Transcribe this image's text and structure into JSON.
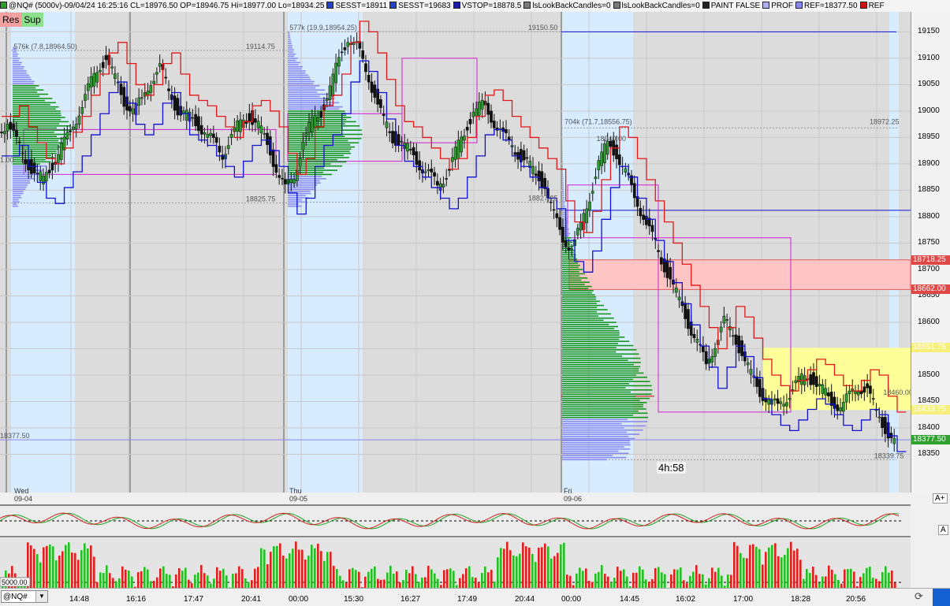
{
  "header": {
    "items": [
      {
        "text": "@NQ# (5000v)-09/04/24 16:25:16 CL=18976.50 OP=18946.75 Hi=18977.00 Lo=18934.25",
        "color": "#2aa02a"
      },
      {
        "text": "SESST=18911",
        "color": "#2244cc"
      },
      {
        "text": "SESST=19683",
        "color": "#2244cc"
      },
      {
        "text": "VSTOP=18878.5",
        "color": "#1a1aa8"
      },
      {
        "text": "lsLookBackCandles=0",
        "color": "#7a7a7a"
      },
      {
        "text": "lsLookBackCandles=0",
        "color": "#7a7a7a"
      },
      {
        "text": "PAINT FALSE",
        "color": "#222222"
      },
      {
        "text": "PROF",
        "color": "#b0b0f0"
      },
      {
        "text": "REF=18377.50",
        "color": "#8888ee"
      },
      {
        "text": "REF",
        "color": "#d01010"
      }
    ]
  },
  "buttons": {
    "res_label": "Res",
    "sup_label": "Sup",
    "a_plus": "A+",
    "a_label": "A"
  },
  "price_axis": {
    "ticks": [
      19150,
      19100,
      19050,
      19000,
      18950,
      18900,
      18850,
      18800,
      18750,
      18700,
      18650,
      18600,
      18550,
      18500,
      18450,
      18400,
      18350
    ],
    "tags": [
      {
        "text": "18718.25",
        "value": 18718.25,
        "bg": "#e04848"
      },
      {
        "text": "18662.00",
        "value": 18662.0,
        "bg": "#e04848"
      },
      {
        "text": "18551.75",
        "value": 18551.75,
        "bg": "#f6ef7a"
      },
      {
        "text": "18433.75",
        "value": 18433.75,
        "bg": "#f6ef7a"
      },
      {
        "text": "18377.50",
        "value": 18377.5,
        "bg": "#30a030"
      }
    ]
  },
  "chart_labels": [
    {
      "text": "576k (7.8,18964.50)",
      "value": 19114.75,
      "x": 0.015
    },
    {
      "text": "19114.75",
      "value": 19114.75,
      "x": 0.27
    },
    {
      "text": "577k (19.9,18954.25)",
      "value": 19150.5,
      "x": 0.318
    },
    {
      "text": "19150.50",
      "value": 19150.5,
      "x": 0.58
    },
    {
      "text": "18825.75",
      "value": 18825.75,
      "x": 0.27
    },
    {
      "text": "18827.25",
      "value": 18827.25,
      "x": 0.58
    },
    {
      "text": "704k (71.7,18556.75)",
      "value": 18972.25,
      "x": 0.62
    },
    {
      "text": "18972.25",
      "value": 18972.25,
      "x": 0.955
    },
    {
      "text": "18940.00",
      "value": 18940.0,
      "x": 0.655
    },
    {
      "text": "18460.00",
      "value": 18460.0,
      "x": 0.97
    },
    {
      "text": "18339.75",
      "value": 18339.75,
      "x": 0.96
    },
    {
      "text": "18377.50",
      "value": 18377.5,
      "x": 0.0
    },
    {
      "text": "1.00",
      "value": 18900,
      "x": 0.0
    }
  ],
  "day_labels": [
    {
      "day": "Wed",
      "date": "09-04"
    },
    {
      "day": "Thu",
      "date": "09-05"
    },
    {
      "day": "Fri",
      "date": "09-06"
    }
  ],
  "countdown": "4h:58",
  "oscillator_zero": "0",
  "volume_ticks": [
    "10000",
    "0"
  ],
  "volume_ref": "5000.00",
  "time_labels": [
    "14:48",
    "16:16",
    "17:47",
    "20:41",
    "00:00",
    "15:30",
    "16:27",
    "17:49",
    "20:44",
    "00:00",
    "14:45",
    "16:02",
    "17:00",
    "18:28",
    "20:56"
  ],
  "symbol": "@NQ#",
  "colors": {
    "candle_up": "#2e9c2e",
    "candle_down": "#111111",
    "red_line": "#e01818",
    "blue_line": "#1010d0",
    "magenta_line": "#d020d0",
    "profile_bg": "#d8ecff",
    "profile_hist": "#8a8af0",
    "value_area": "#14961c",
    "res_zone": "#ffc4c4",
    "sup_zone": "#ffff9a"
  },
  "chart_data": {
    "type": "candlestick",
    "instrument": "@NQ#",
    "ylim": [
      18300,
      19170
    ],
    "levels": {
      "REF": 18377.5,
      "VSTOP": 18878.5,
      "resistance_zone": [
        18662.0,
        18718.25
      ],
      "support_zone": [
        18433.75,
        18551.75
      ]
    },
    "close_path": [
      18960,
      18980,
      18940,
      18910,
      18880,
      18870,
      18900,
      18930,
      18960,
      19000,
      19040,
      19080,
      19100,
      19060,
      19020,
      19000,
      19020,
      19060,
      19080,
      19040,
      19000,
      18990,
      18980,
      18960,
      18940,
      18920,
      18950,
      18980,
      18990,
      18970,
      18940,
      18890,
      18850,
      18880,
      18940,
      18980,
      19000,
      19040,
      19100,
      19140,
      19120,
      19080,
      19030,
      18980,
      18950,
      18940,
      18920,
      18900,
      18880,
      18860,
      18880,
      18920,
      18960,
      19000,
      19010,
      18990,
      18960,
      18940,
      18920,
      18900,
      18880,
      18860,
      18800,
      18760,
      18740,
      18780,
      18840,
      18900,
      18940,
      18920,
      18880,
      18840,
      18800,
      18760,
      18720,
      18680,
      18640,
      18600,
      18560,
      18520,
      18560,
      18600,
      18580,
      18540,
      18500,
      18470,
      18450,
      18440,
      18460,
      18480,
      18500,
      18490,
      18470,
      18450,
      18440,
      18460,
      18480,
      18470,
      18430,
      18400,
      18370
    ]
  }
}
